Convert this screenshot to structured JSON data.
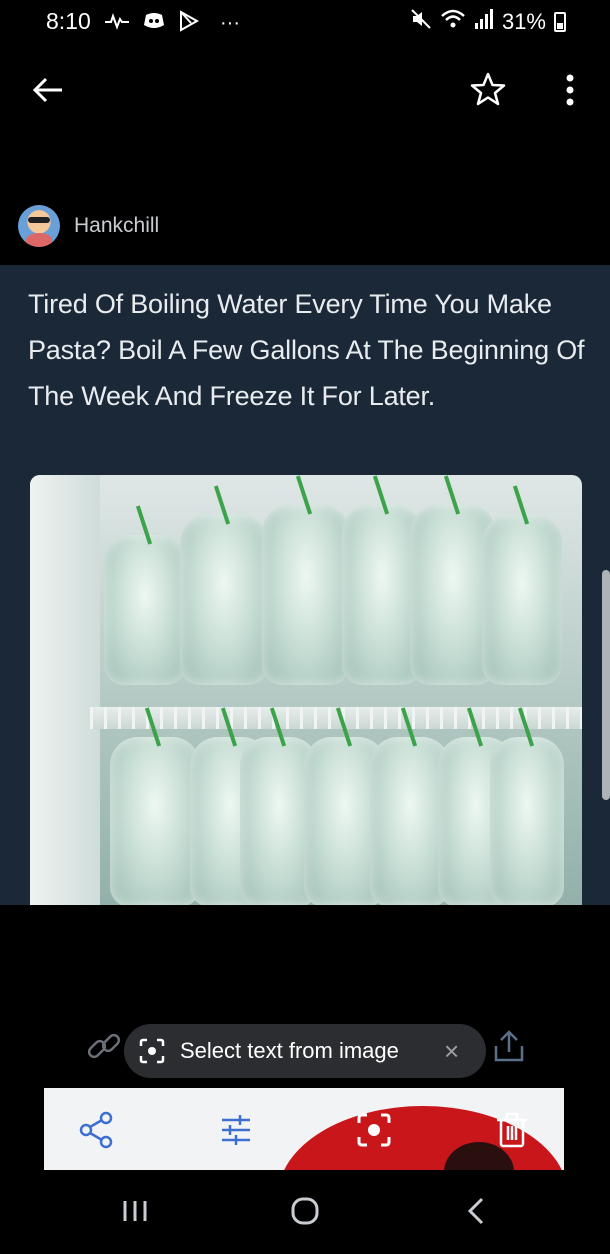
{
  "status_bar": {
    "time": "8:10",
    "more": "···",
    "battery": "31%",
    "icons": [
      "heartbeat-icon",
      "discord-icon",
      "play-store-icon",
      "mute-icon",
      "wifi-icon",
      "signal-icon",
      "battery-icon"
    ]
  },
  "app_bar": {
    "icons": [
      "back-arrow-icon",
      "star-icon",
      "more-vert-icon"
    ]
  },
  "post": {
    "author": "Hankchill",
    "title": "Tired Of Boiling Water Every Time You Make Pasta? Boil A Few Gallons At The Beginning Of The Week And Freeze It For Later."
  },
  "lens_bar": {
    "chip_label": "Select text from image",
    "chip_close": "×",
    "icons": [
      "link-icon",
      "lens-icon",
      "close-icon",
      "share-icon"
    ]
  },
  "toolbar": {
    "icons": [
      "share-nodes-icon",
      "adjust-sliders-icon",
      "lens-icon",
      "trash-icon"
    ]
  },
  "nav_bar": {
    "icons": [
      "recents-icon",
      "home-icon",
      "back-chevron-icon"
    ]
  },
  "colors": {
    "post_background": "#1b2838",
    "chip_background": "#2b2d31",
    "toolbar_background": "#f2f3f5",
    "accent_red": "#c8161b"
  }
}
